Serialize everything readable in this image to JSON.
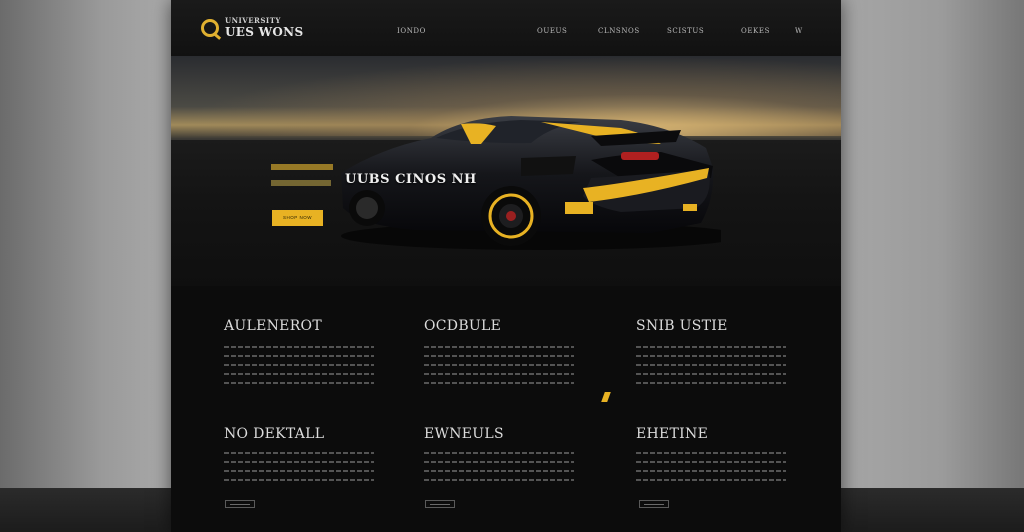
{
  "header": {
    "logo_top": "UNIVERSITY",
    "logo_name": "UES WONS",
    "nav": [
      "",
      "IONDO",
      "",
      "OUEUS",
      "CLNSNOS",
      "SCISTUS",
      "OEKES",
      "W"
    ]
  },
  "hero": {
    "title": "UUBS CINOS NH",
    "button_label": "SHOP NOW"
  },
  "columns": [
    {
      "title": "AULENEROT"
    },
    {
      "title": "OCDBULE"
    },
    {
      "title": "SNIB USTIE"
    },
    {
      "title": "NO DEKTALL"
    },
    {
      "title": "EWNEULS"
    },
    {
      "title": "EHETINE"
    }
  ],
  "colors": {
    "accent": "#e8b223",
    "page_bg": "#0d0d0d"
  }
}
